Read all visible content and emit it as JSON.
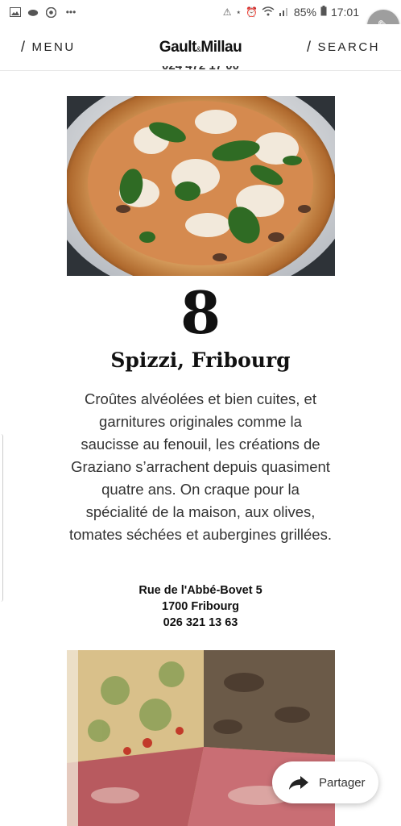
{
  "status_bar": {
    "left_icons": [
      "image-icon",
      "cloud-icon",
      "chrome-icon",
      "more-icon"
    ],
    "battery": "85%",
    "time": "17:01"
  },
  "header": {
    "menu_label": "MENU",
    "search_label": "SEARCH",
    "brand": "Gault",
    "brand_amp": "&",
    "brand_2": "Millau"
  },
  "previous_phone_partial": "024 472 17 00",
  "listing": {
    "rank": "8",
    "name": "Spizzi, Fribourg",
    "description": "Croûtes alvéolées et bien cuites, et garnitures originales comme la saucisse au fenouil, les créations de Graziano s’arrachent depuis quasiment quatre ans. On craque pour la spécialité de la maison, aux olives, tomates séchées et aubergines grillées.",
    "address_line1": "Rue de l'Abbé-Bovet 5",
    "address_line2": "1700 Fribourg",
    "phone": "026 321 13 63"
  },
  "share": {
    "label": "Partager"
  }
}
